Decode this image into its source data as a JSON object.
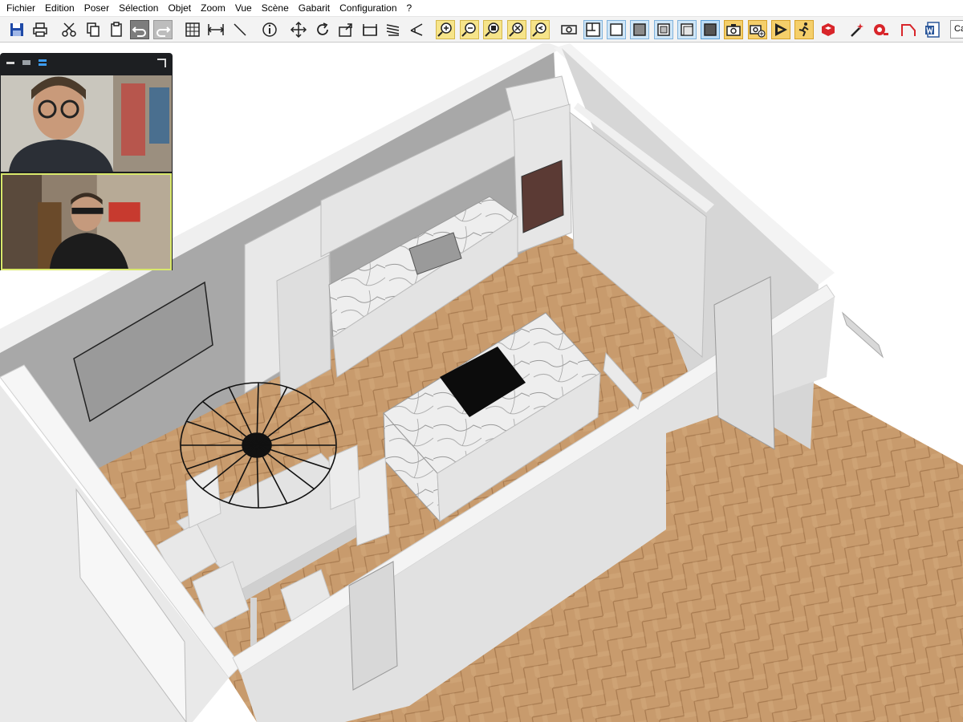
{
  "menu": [
    "Fichier",
    "Edition",
    "Poser",
    "Sélection",
    "Objet",
    "Zoom",
    "Vue",
    "Scène",
    "Gabarit",
    "Configuration",
    "?"
  ],
  "toolbar": {
    "items": [
      "save-icon",
      "print-icon",
      "cut-icon",
      "copy-icon",
      "paste-icon",
      "undo-icon",
      "redo-icon",
      "grid-icon",
      "dimension-icon",
      "line-icon",
      "info-icon",
      "move-icon",
      "rotate-icon",
      "export-icon",
      "wall-icon",
      "stair-icon",
      "ramp-icon",
      "zoom-in-icon",
      "zoom-out-icon",
      "zoom-fit-icon",
      "zoom-window-icon",
      "zoom-previous-icon",
      "view-2d-icon",
      "plan-view-icon",
      "view-box-icon",
      "view-shade-icon",
      "view-lines-icon",
      "view-transparent-icon",
      "view-solid-icon",
      "camera-icon",
      "camera-add-icon",
      "render-icon",
      "walk-icon",
      "sketchup-icon",
      "magic-wand-icon",
      "tape-icon",
      "pencil-icon",
      "word-export-icon"
    ],
    "combo_value": "Ca"
  },
  "video_call": {
    "participants": [
      "participant-1",
      "participant-2"
    ],
    "active_speaker_color": "#d9e86b"
  },
  "colors": {
    "floor": "#c89b6d",
    "wall_top": "#f5f5f5",
    "wall_side": "#dcdcdc",
    "accent_blue": "#3d9cf0"
  }
}
